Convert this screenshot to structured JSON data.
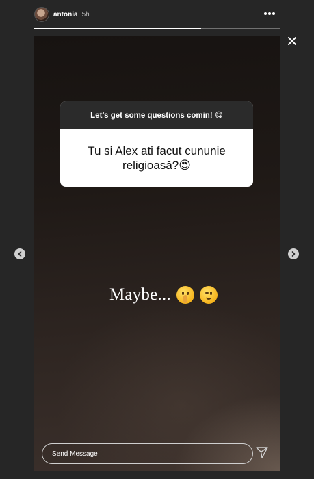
{
  "header": {
    "username": "antonia",
    "time": "5h"
  },
  "story": {
    "progress": 0.68,
    "question_card": {
      "prompt": "Let’s get some questions comin! 😋",
      "question_text": "Tu si Alex ati facut cununie religioasă?😍"
    },
    "answer": {
      "text": "Maybe..."
    }
  },
  "footer": {
    "message_placeholder": "Send Message"
  },
  "icons": {
    "more": "more-options-icon",
    "close": "close-icon",
    "send": "send-icon",
    "prev": "chevron-left-icon",
    "next": "chevron-right-icon"
  }
}
